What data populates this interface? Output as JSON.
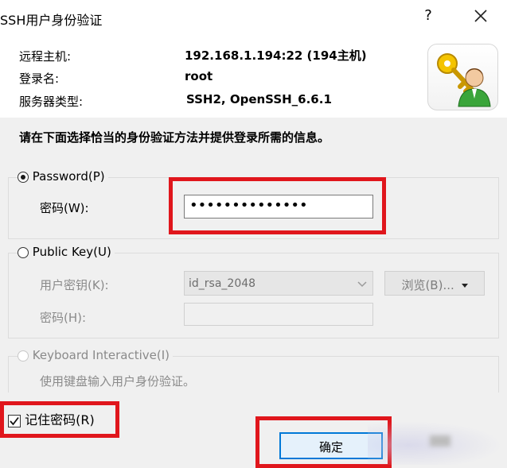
{
  "window": {
    "title": "SSH用户身份验证",
    "help_label": "?",
    "close_label": "✕"
  },
  "info": {
    "host_label": "远程主机:",
    "host_value": "192.168.1.194:22 (194主机)",
    "login_label": "登录名:",
    "login_value": "root",
    "server_type_label": "服务器类型:",
    "server_type_value": "SSH2, OpenSSH_6.6.1",
    "logo_icon": "key-user-icon"
  },
  "instruction": "请在下面选择恰当的身份验证方法并提供登录所需的信息。",
  "password_group": {
    "label": "Password(P)",
    "selected": true,
    "password_label": "密码(W):",
    "password_value": "••••••••••••••"
  },
  "publickey_group": {
    "label": "Public Key(U)",
    "selected": false,
    "key_label": "用户密钥(K):",
    "key_value": "id_rsa_2048",
    "browse_label": "浏览(B)...",
    "passphrase_label": "密码(H):"
  },
  "keyboard_group": {
    "label": "Keyboard Interactive(I)",
    "selected": false,
    "description": "使用键盘输入用户身份验证。"
  },
  "remember": {
    "label": "记住密码(R)",
    "checked": true
  },
  "buttons": {
    "ok_label": "确定"
  },
  "colors": {
    "highlight_red": "#e0161c",
    "dialog_bg": "#f0f0f0",
    "ok_border": "#0078d7"
  }
}
